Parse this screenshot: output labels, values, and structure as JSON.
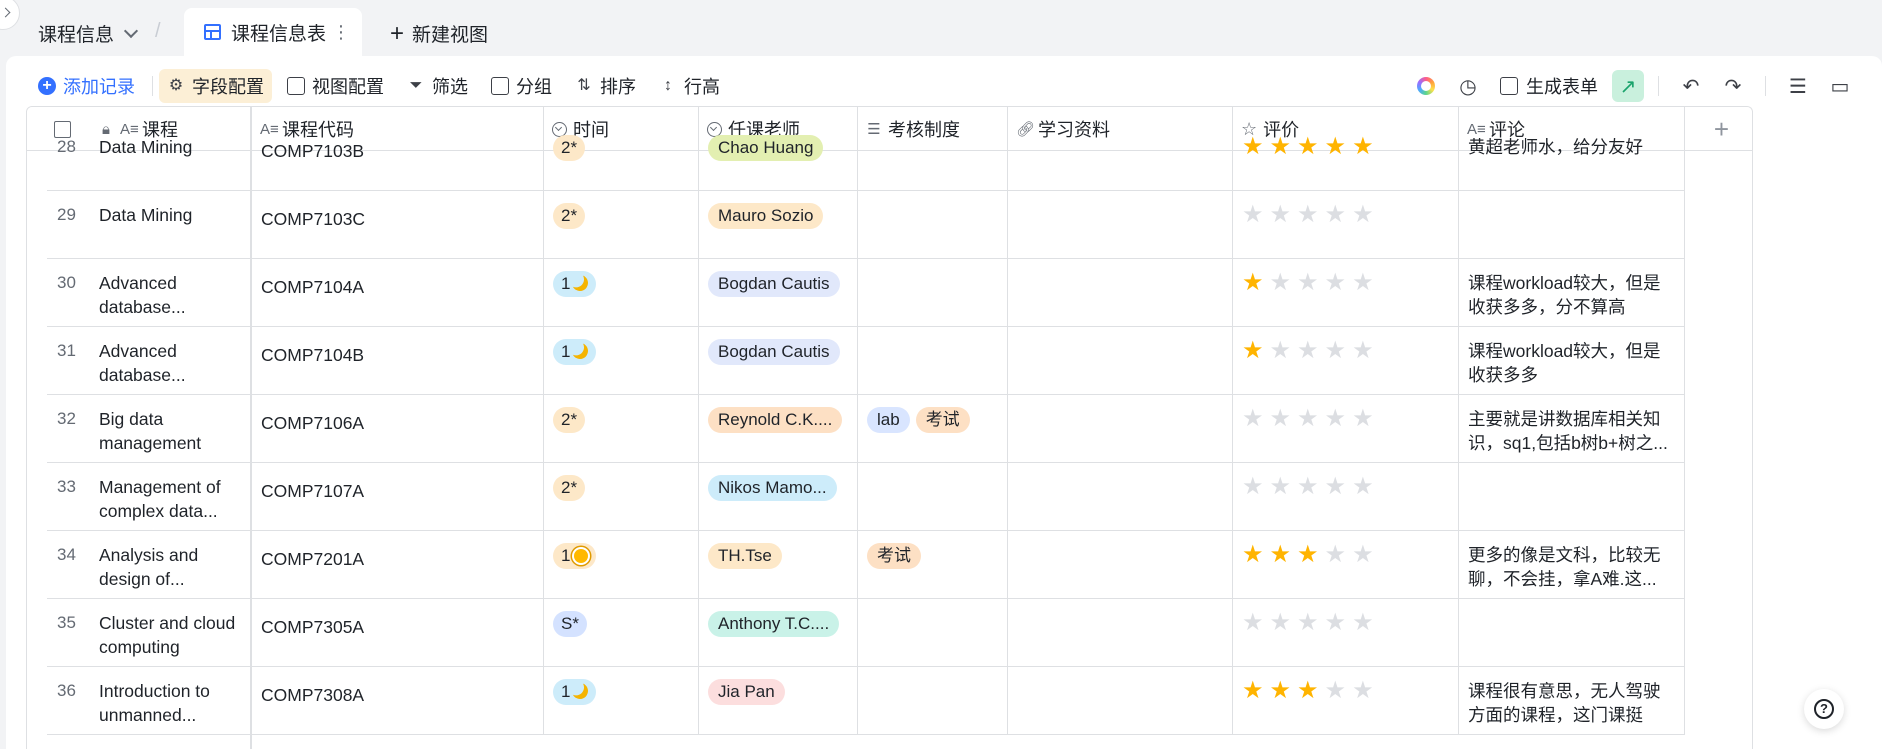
{
  "topbar": {
    "base_name": "课程信息",
    "active_tab": "课程信息表",
    "new_view": "新建视图"
  },
  "toolbar": {
    "add_record": "添加记录",
    "field_config": "字段配置",
    "view_config": "视图配置",
    "filter": "筛选",
    "group": "分组",
    "sort": "排序",
    "row_height": "行高",
    "generate_form": "生成表单"
  },
  "columns": {
    "course": "课程",
    "code": "课程代码",
    "time": "时间",
    "teacher": "任课老师",
    "exam": "考核制度",
    "materials": "学习资料",
    "rating": "评价",
    "comment": "评论"
  },
  "rows": [
    {
      "num": "28",
      "name": [
        "Data Mining"
      ],
      "code": "COMP7103B",
      "time": "2*",
      "time_icon": "",
      "teacher": "Chao Huang",
      "teacher_color": "#e3efb1",
      "exam": [],
      "rating": 5,
      "comment": [
        "黄超老师水，给分友好"
      ]
    },
    {
      "num": "29",
      "name": [
        "Data Mining"
      ],
      "code": "COMP7103C",
      "time": "2*",
      "time_icon": "",
      "teacher": "Mauro Sozio",
      "teacher_color": "#fde8c8",
      "exam": [],
      "rating": 0,
      "comment": []
    },
    {
      "num": "30",
      "name": [
        "Advanced",
        "database..."
      ],
      "code": "COMP7104A",
      "time": "1",
      "time_icon": "moon",
      "teacher": "Bogdan Cautis",
      "teacher_color": "#e1e8fb",
      "exam": [],
      "rating": 1,
      "comment": [
        "课程workload较大，但是",
        "收获多多，分不算高"
      ]
    },
    {
      "num": "31",
      "name": [
        "Advanced",
        "database..."
      ],
      "code": "COMP7104B",
      "time": "1",
      "time_icon": "moon",
      "teacher": "Bogdan Cautis",
      "teacher_color": "#e1e8fb",
      "exam": [],
      "rating": 1,
      "comment": [
        "课程workload较大，但是",
        "收获多多"
      ]
    },
    {
      "num": "32",
      "name": [
        "Big data",
        "management"
      ],
      "code": "COMP7106A",
      "time": "2*",
      "time_icon": "",
      "teacher": "Reynold C.K....",
      "teacher_color": "#fde0c4",
      "exam": [
        "lab",
        "考试"
      ],
      "rating": 0,
      "comment": [
        "主要就是讲数据库相关知",
        "识，sq1,包括b树b+树之..."
      ]
    },
    {
      "num": "33",
      "name": [
        "Management of",
        "complex data..."
      ],
      "code": "COMP7107A",
      "time": "2*",
      "time_icon": "",
      "teacher": "Nikos Mamo...",
      "teacher_color": "#cdecfa",
      "exam": [],
      "rating": 0,
      "comment": []
    },
    {
      "num": "34",
      "name": [
        "Analysis and",
        "design of..."
      ],
      "code": "COMP7201A",
      "time": "1",
      "time_icon": "sun",
      "teacher": "TH.Tse",
      "teacher_color": "#fde8c8",
      "exam": [
        "考试"
      ],
      "rating": 3,
      "comment": [
        "更多的像是文科，比较无",
        "聊，不会挂，拿A难.这..."
      ]
    },
    {
      "num": "35",
      "name": [
        "Cluster and cloud",
        "computing"
      ],
      "code": "COMP7305A",
      "time": "S*",
      "time_icon": "",
      "teacher": "Anthony T.C....",
      "teacher_color": "#c9f2e8",
      "exam": [],
      "rating": 0,
      "comment": []
    },
    {
      "num": "36",
      "name": [
        "Introduction to",
        "unmanned..."
      ],
      "code": "COMP7308A",
      "time": "1",
      "time_icon": "moon",
      "teacher": "Jia Pan",
      "teacher_color": "#fcdede",
      "exam": [],
      "rating": 3,
      "comment": [
        "课程很有意思，无人驾驶",
        "方面的课程，这门课挺"
      ]
    }
  ]
}
